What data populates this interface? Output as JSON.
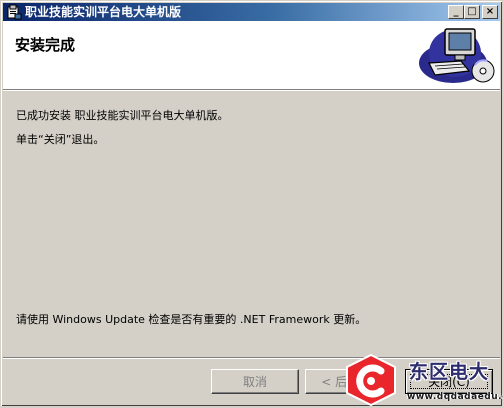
{
  "window": {
    "title": "职业技能实训平台电大单机版",
    "controls": {
      "minimize": "_",
      "maximize": "□",
      "close": "×"
    }
  },
  "header": {
    "title": "安装完成",
    "logo_icon": "computer-setup-icon"
  },
  "body": {
    "installed_message": "已成功安装 职业技能实训平台电大单机版。",
    "close_instruction": "单击“关闭”退出。",
    "update_notice": "请使用 Windows Update 检查是否有重要的 .NET Framework 更新。"
  },
  "buttons": {
    "cancel": "取消",
    "back": "< 后退(B)",
    "close": "关闭(C)"
  },
  "watermark": {
    "name": "东区电大",
    "url": "www.dqdadaedu.com",
    "colors": {
      "logo": "#e8262b",
      "text": "#2c2c6e"
    }
  },
  "colors": {
    "titlebar_start": "#0a246a",
    "titlebar_end": "#a6caf0",
    "face": "#d4d0c8"
  }
}
